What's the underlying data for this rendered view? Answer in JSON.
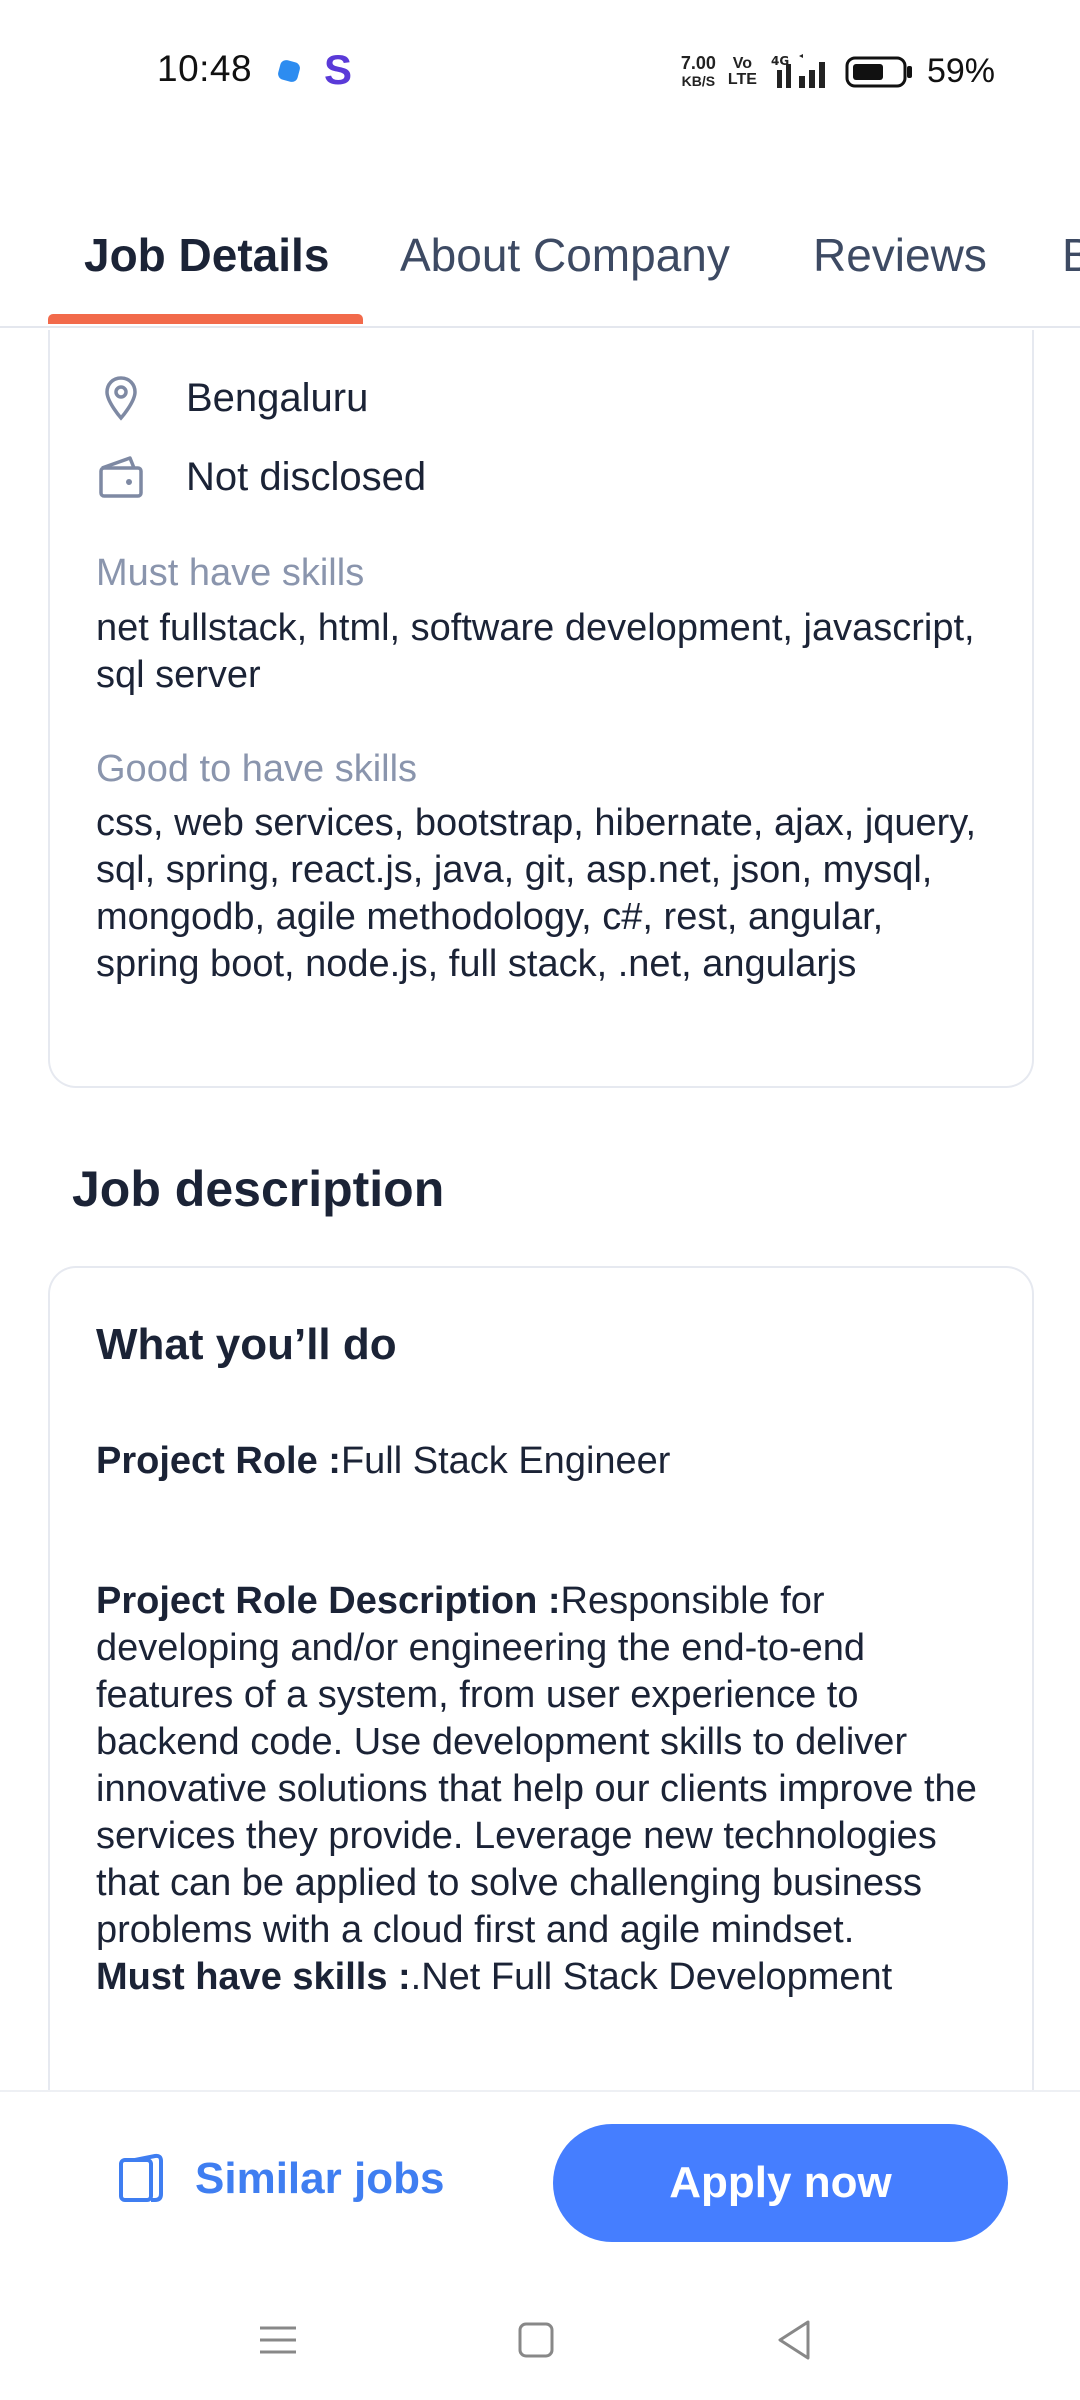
{
  "status_bar": {
    "time": "10:48",
    "net_speed_value": "7.00",
    "net_speed_unit": "KB/S",
    "volte_top": "Vo",
    "volte_bottom": "LTE",
    "network": "4G",
    "battery": "59%"
  },
  "tabs": [
    {
      "label": "Job Details",
      "active": true
    },
    {
      "label": "About Company",
      "active": false
    },
    {
      "label": "Reviews",
      "active": false
    },
    {
      "label": "B",
      "active": false
    }
  ],
  "job_details": {
    "location": "Bengaluru",
    "salary": "Not disclosed",
    "must_have_label": "Must have skills",
    "must_have_skills": "net fullstack, html, software development, javascript, sql server",
    "good_to_have_label": "Good to have skills",
    "good_to_have_skills": "css, web services, bootstrap, hibernate, ajax, jquery, sql, spring, react.js, java, git, asp.net, json, mysql, mongodb, agile methodology, c#, rest, angular, spring boot, node.js, full stack, .net, angularjs"
  },
  "job_description": {
    "section_title": "Job description",
    "card_title": "What you’ll do",
    "project_role_label": "Project Role :",
    "project_role_value": "Full Stack Engineer",
    "role_desc_label": "Project Role Description :",
    "role_desc_value": "Responsible for developing and/or engineering the end-to-end features of a system, from user experience to backend code. Use development skills to deliver innovative solutions that help our clients improve the services they provide. Leverage new technologies that can be applied to solve challenging business problems with a cloud first and agile mindset.",
    "must_have_label": "Must have skills :",
    "must_have_value": ".Net Full Stack Development"
  },
  "actions": {
    "similar_jobs": "Similar jobs",
    "apply_now": "Apply now"
  },
  "colors": {
    "accent": "#457eff",
    "tab_indicator": "#f26a4b",
    "muted_label": "#8a95ad"
  }
}
